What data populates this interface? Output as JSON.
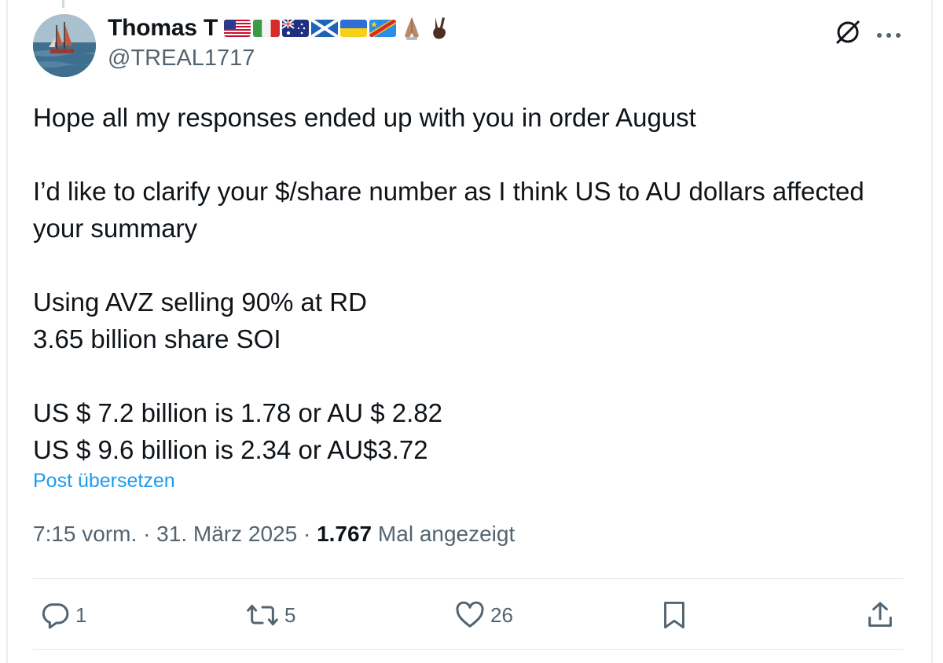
{
  "author": {
    "display_name": "Thomas T",
    "handle": "@TREAL1717",
    "avatar_icon": "sailboat-avatar",
    "flags": [
      "flag-usa-icon",
      "flag-italy-icon",
      "flag-australia-icon",
      "flag-scotland-icon",
      "flag-ukraine-icon",
      "flag-dr-congo-icon"
    ],
    "emojis": [
      "folded-hands-icon",
      "victory-hand-icon"
    ]
  },
  "header_icons": [
    "grok-icon",
    "more-options-icon"
  ],
  "post": {
    "text": "Hope all my responses ended up with you in order August\n\nI’d like to clarify your $/share number as I think US to AU dollars affected your summary\n\nUsing AVZ selling 90% at RD\n3.65 billion share SOI\n\nUS $ 7.2 billion is 1.78 or AU $ 2.82\nUS $ 9.6 billion is 2.34 or AU$3.72",
    "translate_label": "Post übersetzen"
  },
  "meta": {
    "time": "7:15 vorm.",
    "separator": "·",
    "date": "31. März 2025",
    "views_count": "1.767",
    "views_label": "Mal angezeigt"
  },
  "actions": {
    "replies": "1",
    "reposts": "5",
    "likes": "26"
  },
  "colors": {
    "text": "#0f1419",
    "secondary": "#536471",
    "link": "#1d9bf0",
    "divider": "#e6ebee"
  }
}
